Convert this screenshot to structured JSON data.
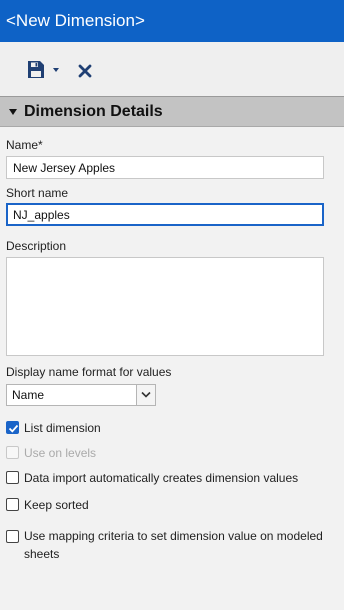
{
  "window": {
    "title": "<New Dimension>"
  },
  "toolbar": {
    "save_icon": "save-icon",
    "dropdown_icon": "caret-down-icon",
    "close_icon": "close-icon"
  },
  "section": {
    "title": "Dimension Details",
    "expanded": true
  },
  "form": {
    "name_label": "Name*",
    "name_value": "New Jersey Apples",
    "short_name_label": "Short name",
    "short_name_value": "NJ_apples",
    "description_label": "Description",
    "description_value": "",
    "display_format_label": "Display name format for values",
    "display_format_value": "Name"
  },
  "checkboxes": [
    {
      "label": "List dimension",
      "checked": true,
      "disabled": false
    },
    {
      "label": "Use on levels",
      "checked": false,
      "disabled": true
    },
    {
      "label": "Data import automatically creates dimension values",
      "checked": false,
      "disabled": false
    },
    {
      "label": "Keep sorted",
      "checked": false,
      "disabled": false
    },
    {
      "label": "Use mapping criteria to set dimension value on modeled sheets",
      "checked": false,
      "disabled": false
    }
  ],
  "colors": {
    "title_bar": "#0e62c6",
    "accent": "#1a64c8",
    "section_header": "#c3c3c3",
    "panel": "#f2f2f2"
  }
}
